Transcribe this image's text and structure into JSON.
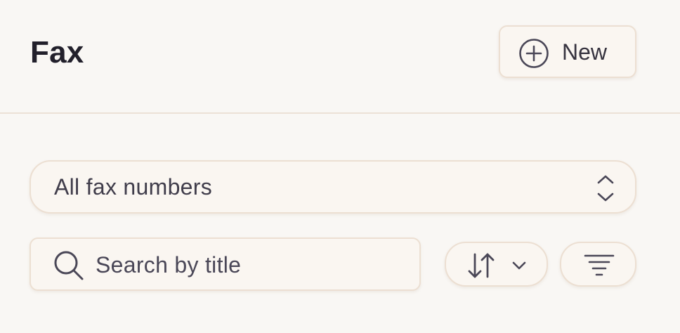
{
  "header": {
    "title": "Fax",
    "new_button_label": "New",
    "new_button_icon": "plus-circle-icon"
  },
  "filters": {
    "fax_number_select": {
      "selected": "All fax numbers",
      "icon": "chevron-up-down-icon"
    },
    "search": {
      "placeholder": "Search by title",
      "value": "",
      "icon": "search-icon"
    },
    "sort_icon": "sort-arrows-icon",
    "filter_icon": "filter-lines-icon"
  },
  "colors": {
    "background": "#f9f7f4",
    "border": "#ecdfd2",
    "icon": "#4a4757",
    "title": "#22202b"
  }
}
